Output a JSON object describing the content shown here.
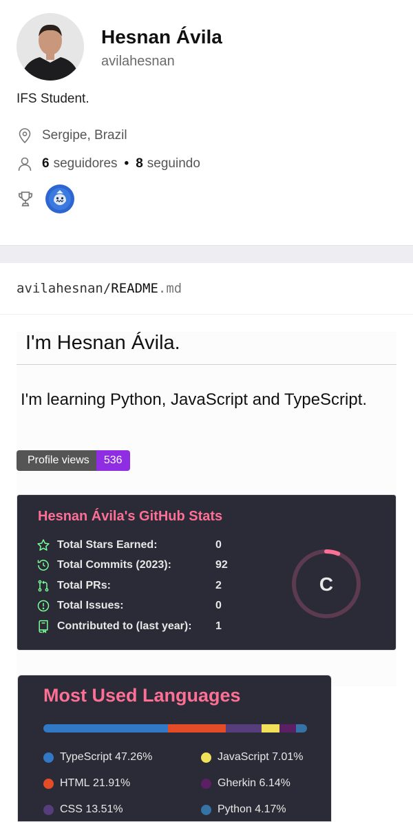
{
  "profile": {
    "name": "Hesnan Ávila",
    "username": "avilahesnan",
    "bio": "IFS Student.",
    "location": "Sergipe, Brazil",
    "followers_count": "6",
    "followers_label": "seguidores",
    "following_count": "8",
    "following_label": "seguindo"
  },
  "readme_header": {
    "owner": "avilahesnan/",
    "file": "README",
    "ext": ".md"
  },
  "readme": {
    "heading": "I'm Hesnan Ávila.",
    "subheading": "I'm learning Python, JavaScript and TypeScript.",
    "views_label": "Profile views",
    "views_count": "536"
  },
  "stats_card": {
    "title": "Hesnan Ávila's GitHub Stats",
    "grade": "C",
    "grade_progress": 0.06,
    "accent": "#fe6f95",
    "items": [
      {
        "label": "Total Stars Earned:",
        "value": "0",
        "icon": "star-icon"
      },
      {
        "label": "Total Commits (2023):",
        "value": "92",
        "icon": "history-icon"
      },
      {
        "label": "Total PRs:",
        "value": "2",
        "icon": "pull-request-icon"
      },
      {
        "label": "Total Issues:",
        "value": "0",
        "icon": "issue-icon"
      },
      {
        "label": "Contributed to (last year):",
        "value": "1",
        "icon": "repo-icon"
      }
    ]
  },
  "languages_card": {
    "title": "Most Used Languages",
    "languages": [
      {
        "name": "TypeScript",
        "percent": "47.26%",
        "value": 47.26,
        "color": "#3178c6"
      },
      {
        "name": "HTML",
        "percent": "21.91%",
        "value": 21.91,
        "color": "#e34c26"
      },
      {
        "name": "CSS",
        "percent": "13.51%",
        "value": 13.51,
        "color": "#563d7c"
      },
      {
        "name": "JavaScript",
        "percent": "7.01%",
        "value": 7.01,
        "color": "#f1e05a"
      },
      {
        "name": "Gherkin",
        "percent": "6.14%",
        "value": 6.14,
        "color": "#5b2063"
      },
      {
        "name": "Python",
        "percent": "4.17%",
        "value": 4.17,
        "color": "#3572a5"
      }
    ]
  }
}
